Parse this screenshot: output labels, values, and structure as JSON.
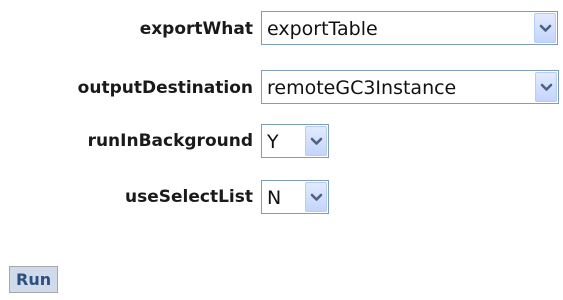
{
  "form": {
    "fields": [
      {
        "label": "exportWhat",
        "value": "exportTable"
      },
      {
        "label": "outputDestination",
        "value": "remoteGC3Instance"
      },
      {
        "label": "runInBackground",
        "value": "Y"
      },
      {
        "label": "useSelectList",
        "value": "N"
      }
    ]
  },
  "actions": {
    "run_label": "Run"
  },
  "icons": {
    "dropdown": "chevron-down-icon"
  },
  "colors": {
    "select_border": "#7f9db9",
    "arrow_button": "#c3d5fb",
    "arrow_glyph": "#4d6185",
    "run_button_bg": "#cfdbeb",
    "run_button_text": "#2f4f7f"
  }
}
